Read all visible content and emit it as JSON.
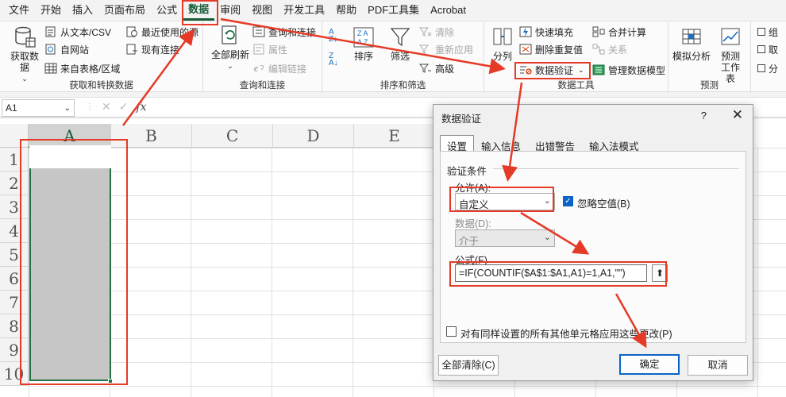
{
  "menubar": {
    "tabs": [
      "文件",
      "开始",
      "插入",
      "页面布局",
      "公式",
      "数据",
      "审阅",
      "视图",
      "开发工具",
      "帮助",
      "PDF工具集",
      "Acrobat"
    ],
    "active_index": 5
  },
  "ribbon": {
    "get_data": {
      "label": "获取和转换数据",
      "big_button": "获取数据",
      "items": [
        "从文本/CSV",
        "自网站",
        "来自表格/区域",
        "最近使用的源",
        "现有连接"
      ]
    },
    "queries": {
      "label": "查询和连接",
      "big_button": "全部刷新",
      "items": [
        "查询和连接",
        "属性",
        "编辑链接"
      ]
    },
    "sort_filter": {
      "label": "排序和筛选",
      "sort": "排序",
      "filter": "筛选",
      "items": [
        "清除",
        "重新应用",
        "高级"
      ]
    },
    "data_tools": {
      "label": "数据工具",
      "split": "分列",
      "items": [
        "快速填充",
        "删除重复值",
        "数据验证",
        "合并计算",
        "关系",
        "管理数据模型"
      ]
    },
    "forecast": {
      "label": "预测",
      "whatif": "模拟分析",
      "sheet": "预测工作表"
    },
    "outline": {
      "items": [
        "组",
        "取",
        "分"
      ]
    }
  },
  "formula_bar": {
    "namebox": "A1",
    "fx": "fx"
  },
  "sheet": {
    "columns": [
      "A",
      "B",
      "C",
      "D",
      "E"
    ],
    "rows": [
      "1",
      "2",
      "3",
      "4",
      "5",
      "6",
      "7",
      "8",
      "9",
      "10"
    ]
  },
  "dialog": {
    "title": "数据验证",
    "help": "?",
    "close": "✕",
    "tabs": [
      "设置",
      "输入信息",
      "出错警告",
      "输入法模式"
    ],
    "section": "验证条件",
    "allow_label": "允许(A):",
    "allow_value": "自定义",
    "ignore_blank": "忽略空值(B)",
    "data_label": "数据(D):",
    "data_value": "介于",
    "formula_label": "公式(F)",
    "formula_value": "=IF(COUNTIF($A$1:$A1,A1)=1,A1,\"\")",
    "apply_all": "对有同样设置的所有其他单元格应用这些更改(P)",
    "clear_all": "全部清除(C)",
    "ok": "确定",
    "cancel": "取消"
  },
  "colors": {
    "accent": "#217346",
    "annotation": "#e53a25",
    "check": "#0a64c8"
  }
}
